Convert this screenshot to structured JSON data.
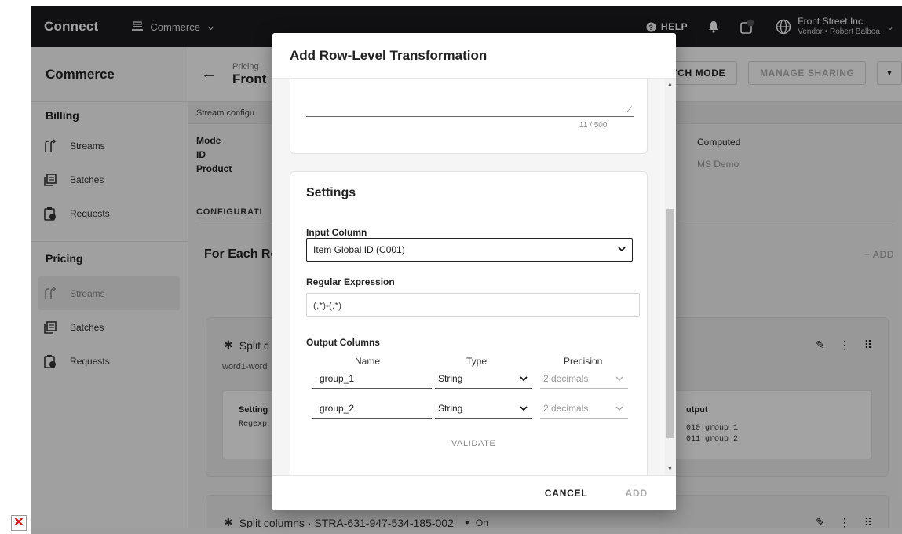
{
  "app": {
    "brand": "Connect",
    "module": "Commerce",
    "help": "HELP",
    "account_name": "Front Street Inc.",
    "account_sub": "Vendor • Robert Balboa"
  },
  "sidebar": {
    "title": "Commerce",
    "sections": [
      {
        "title": "Billing",
        "items": [
          {
            "label": "Streams"
          },
          {
            "label": "Batches"
          },
          {
            "label": "Requests"
          }
        ]
      },
      {
        "title": "Pricing",
        "items": [
          {
            "label": "Streams"
          },
          {
            "label": "Batches"
          },
          {
            "label": "Requests"
          }
        ]
      }
    ]
  },
  "header": {
    "breadcrumb": "Pricing",
    "title": "Front",
    "buttons": {
      "switch_mode": "ITCH MODE",
      "manage_sharing": "MANAGE SHARING"
    }
  },
  "subbar": "Stream configu",
  "details": {
    "labels": [
      "Mode",
      "ID",
      "Product"
    ],
    "computed": "Computed",
    "ms_demo": "MS Demo",
    "configuration": "CONFIGURATI",
    "for_each": "For Each Ro",
    "add": "+ ADD"
  },
  "cards": [
    {
      "title": "Split c",
      "subtitle": "word1-word",
      "settings": "Setting",
      "regex": "Regexp",
      "output_label": "utput",
      "output_lines": [
        "010  group_1",
        "011  group_2"
      ]
    },
    {
      "title": "Split columns · STRA-631-947-534-185-002",
      "status": "On"
    }
  ],
  "dialog": {
    "title": "Add Row-Level Transformation",
    "description_counter": "11 / 500",
    "settings_title": "Settings",
    "input_column_label": "Input Column",
    "input_column_value": "Item Global ID (C001)",
    "regex_label": "Regular Expression",
    "regex_value": "(.*)-(.*)",
    "output_columns_label": "Output Columns",
    "columns_header": {
      "name": "Name",
      "type": "Type",
      "precision": "Precision"
    },
    "output_columns": [
      {
        "name": "group_1",
        "type": "String",
        "precision": "2 decimals"
      },
      {
        "name": "group_2",
        "type": "String",
        "precision": "2 decimals"
      }
    ],
    "validate": "VALIDATE",
    "cancel": "CANCEL",
    "add": "ADD"
  }
}
